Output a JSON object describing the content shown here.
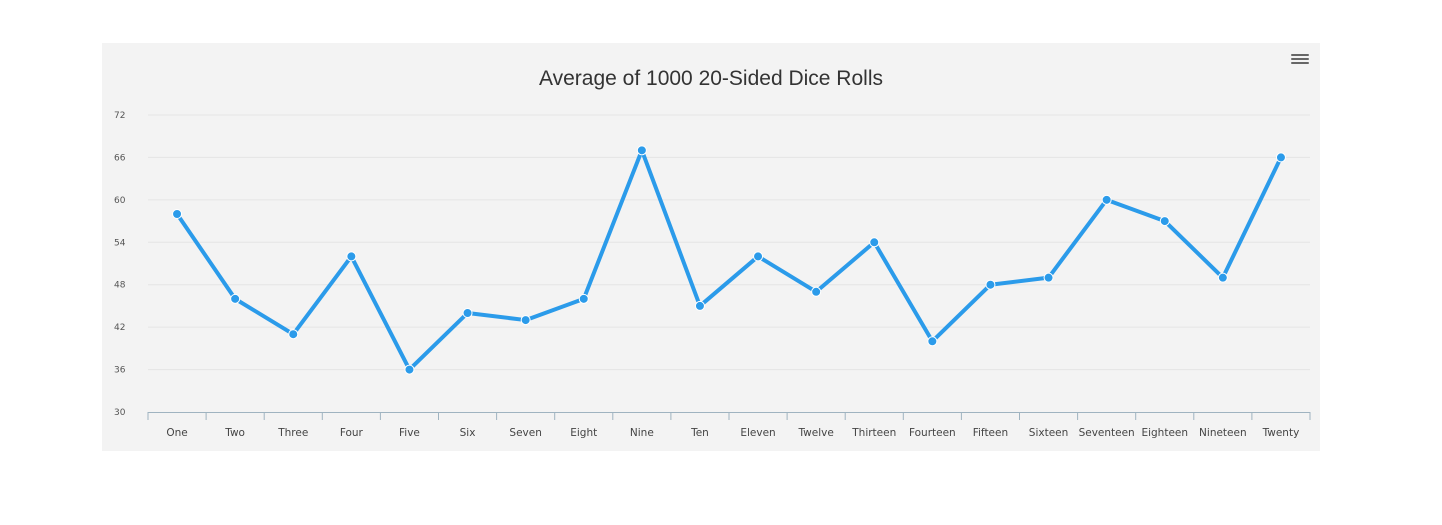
{
  "menu": {
    "icon": "hamburger-menu-icon"
  },
  "chart_data": {
    "type": "line",
    "title": "Average of 1000 20-Sided Dice Rolls",
    "xlabel": "",
    "ylabel": "",
    "categories": [
      "One",
      "Two",
      "Three",
      "Four",
      "Five",
      "Six",
      "Seven",
      "Eight",
      "Nine",
      "Ten",
      "Eleven",
      "Twelve",
      "Thirteen",
      "Fourteen",
      "Fifteen",
      "Sixteen",
      "Seventeen",
      "Eighteen",
      "Nineteen",
      "Twenty"
    ],
    "values": [
      58,
      46,
      41,
      52,
      36,
      44,
      43,
      46,
      67,
      45,
      52,
      47,
      54,
      40,
      48,
      49,
      60,
      57,
      49,
      66
    ],
    "ylim": [
      30,
      72
    ],
    "yticks": [
      30,
      36,
      42,
      48,
      54,
      60,
      66,
      72
    ],
    "grid": true,
    "legend": "none",
    "colors": {
      "line": "#2b9bea",
      "grid": "#e4e4e4",
      "axis": "#9fb3c0",
      "background": "#f3f3f3"
    }
  }
}
